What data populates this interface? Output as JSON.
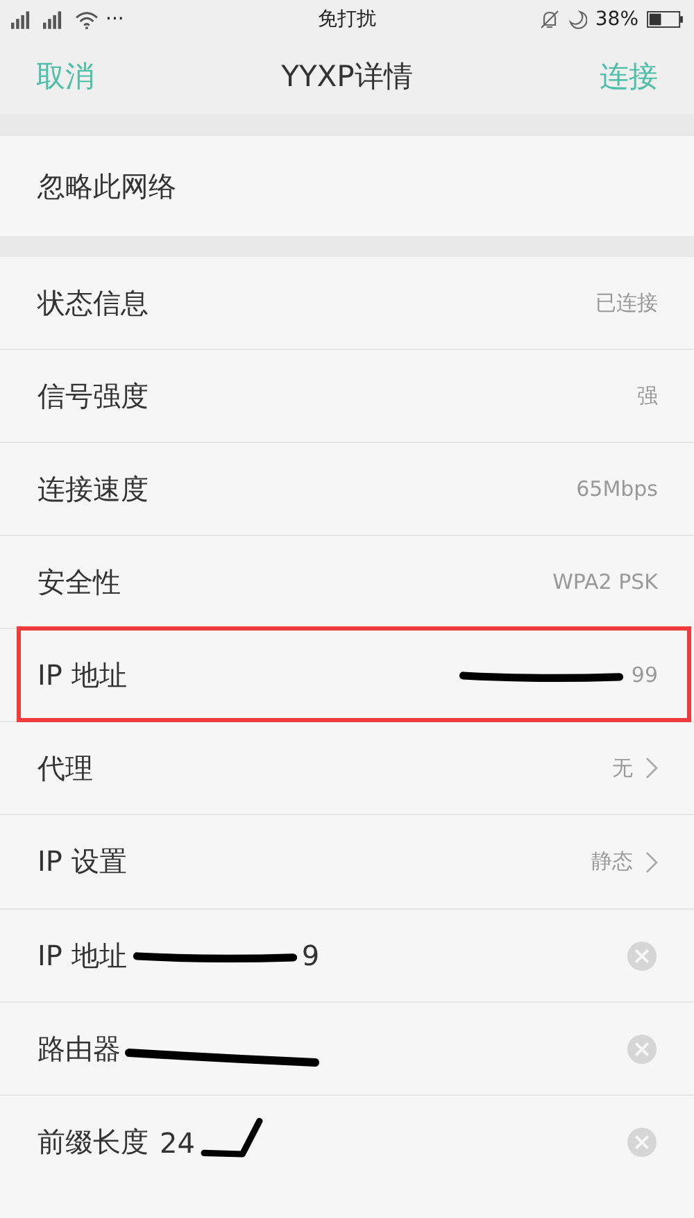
{
  "status_bar": {
    "more": "···",
    "mode": "免打扰",
    "battery_text": "38%"
  },
  "header": {
    "cancel": "取消",
    "title": "YYXP详情",
    "connect": "连接"
  },
  "forget": "忽略此网络",
  "details": [
    {
      "kind": "info",
      "label": "状态信息",
      "value": "已连接",
      "highlighted": false
    },
    {
      "kind": "info",
      "label": "信号强度",
      "value": "强",
      "highlighted": false
    },
    {
      "kind": "info",
      "label": "连接速度",
      "value": "65Mbps",
      "highlighted": false
    },
    {
      "kind": "info",
      "label": "安全性",
      "value": "WPA2 PSK",
      "highlighted": false
    },
    {
      "kind": "info",
      "label": "IP 地址",
      "value": "99",
      "highlighted": true,
      "scribble": {
        "kind": "strike"
      }
    },
    {
      "kind": "nav",
      "label": "代理",
      "value": "无",
      "highlighted": false
    },
    {
      "kind": "nav",
      "label": "IP 设置",
      "value": "静态",
      "highlighted": false
    }
  ],
  "fields": [
    {
      "label": "IP 地址",
      "value": "9",
      "scribble": {
        "kind": "strike"
      }
    },
    {
      "label": "路由器",
      "scribble": {
        "kind": "long"
      }
    },
    {
      "label": "前缀长度",
      "value": "24",
      "scribble": {
        "kind": "check"
      }
    }
  ]
}
